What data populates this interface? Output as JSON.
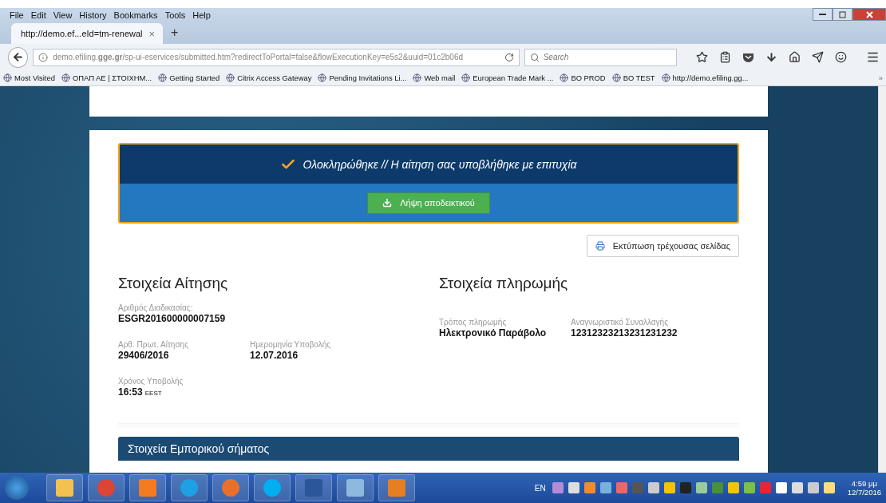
{
  "browser": {
    "menu": [
      "File",
      "Edit",
      "View",
      "History",
      "Bookmarks",
      "Tools",
      "Help"
    ],
    "tab": {
      "title": "http://demo.ef...eId=tm-renewal",
      "close": "×",
      "new": "+"
    },
    "address": "demo.efiling.**gge.gr**/sp-ui-eservices/submitted.htm?redirectToPortal=false&flowExecutionKey=e5s2&uuid=01c2b06d",
    "search": {
      "placeholder": "Search"
    },
    "bookmarks": [
      "Most Visited",
      "ΟΠΑΠ ΑΕ | ΣΤΟΙΧΗΜ...",
      "Getting Started",
      "Citrix Access Gateway",
      "Pending Invitations  Li...",
      "Web mail",
      "European Trade Mark ...",
      "BO PROD",
      "BO TEST",
      "http://demo.efiling.gg..."
    ],
    "bookmarks_more": "»"
  },
  "page": {
    "banner": {
      "message": "Ολοκληρώθηκε // Η αίτηση σας υποβλήθηκε με επιτυχία",
      "button": "Λήψη αποδεικτικού"
    },
    "print_button": "Εκτύπωση τρέχουσας σελίδας",
    "application": {
      "title": "Στοιχεία Αίτησης",
      "rows": [
        [
          {
            "label": "Αριθμός Διαδικασίας:",
            "value": "ESGR201600000007159"
          }
        ],
        [
          {
            "label": "Αρθ. Πρωτ. Αίτησης",
            "value": "29406/2016"
          },
          {
            "label": "Ημερομηνία Υποβολής",
            "value": "12.07.2016"
          }
        ],
        [
          {
            "label": "Χρόνος Υποβολής",
            "value": "16:53",
            "unit": "EEST"
          }
        ]
      ]
    },
    "payment": {
      "title": "Στοιχεία πληρωμής",
      "rows": [
        [
          {
            "label": "Τρόπος πληρωμής",
            "value": "Ηλεκτρονικό Παράβολο"
          },
          {
            "label": "Αναγνωριστικό Συναλλαγής",
            "value": "12312323213231231232"
          }
        ]
      ]
    },
    "trademark_section": {
      "title": "Στοιχεία Εμπορικού σήματος"
    }
  },
  "taskbar": {
    "language": "EN",
    "time": "4:59 μμ",
    "date": "12/7/2016"
  }
}
